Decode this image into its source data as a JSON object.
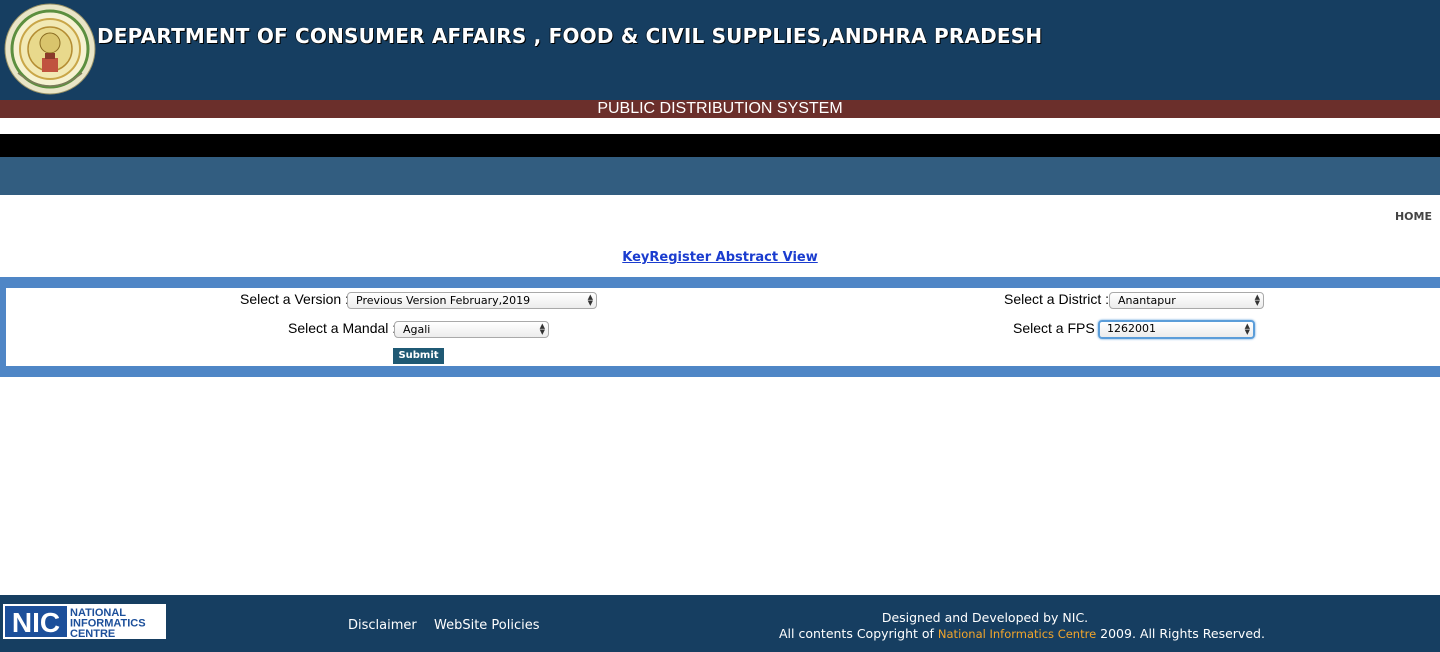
{
  "header": {
    "title": "DEPARTMENT OF CONSUMER AFFAIRS , FOOD & CIVIL SUPPLIES,ANDHRA PRADESH",
    "subtitle": "PUBLIC DISTRIBUTION SYSTEM",
    "emblem_icon": "ap-state-emblem-icon",
    "colors": {
      "header_bg": "#163e61",
      "subtitle_bar": "#6b2f2b",
      "nav_bar": "#325d80"
    }
  },
  "nav": {
    "home_label": "HOME"
  },
  "page_link": {
    "label": "KeyRegister Abstract View"
  },
  "form": {
    "version_label": "Select a Version :",
    "version_value": "Previous Version February,2019",
    "district_label": "Select a District :",
    "district_value": "Anantapur",
    "mandal_label": "Select a Mandal :",
    "mandal_value": "Agali",
    "fps_label": "Select a FPS :",
    "fps_value": "1262001",
    "submit_label": "Submit",
    "colors": {
      "panel_border": "#4f86c6",
      "submit_bg": "#1f5974"
    }
  },
  "footer": {
    "nic_logo": {
      "line1": "NATIONAL",
      "line2": "INFORMATICS",
      "line3": "CENTRE",
      "mark": "NIC"
    },
    "links": [
      "Disclaimer",
      "WebSite Policies"
    ],
    "credit_line1": "Designed and Developed by NIC.",
    "credit_prefix": "All contents Copyright of",
    "credit_org": "National Informatics Centre",
    "credit_suffix": "2009. All Rights Reserved.",
    "colors": {
      "org_highlight": "#f2a52b"
    }
  }
}
